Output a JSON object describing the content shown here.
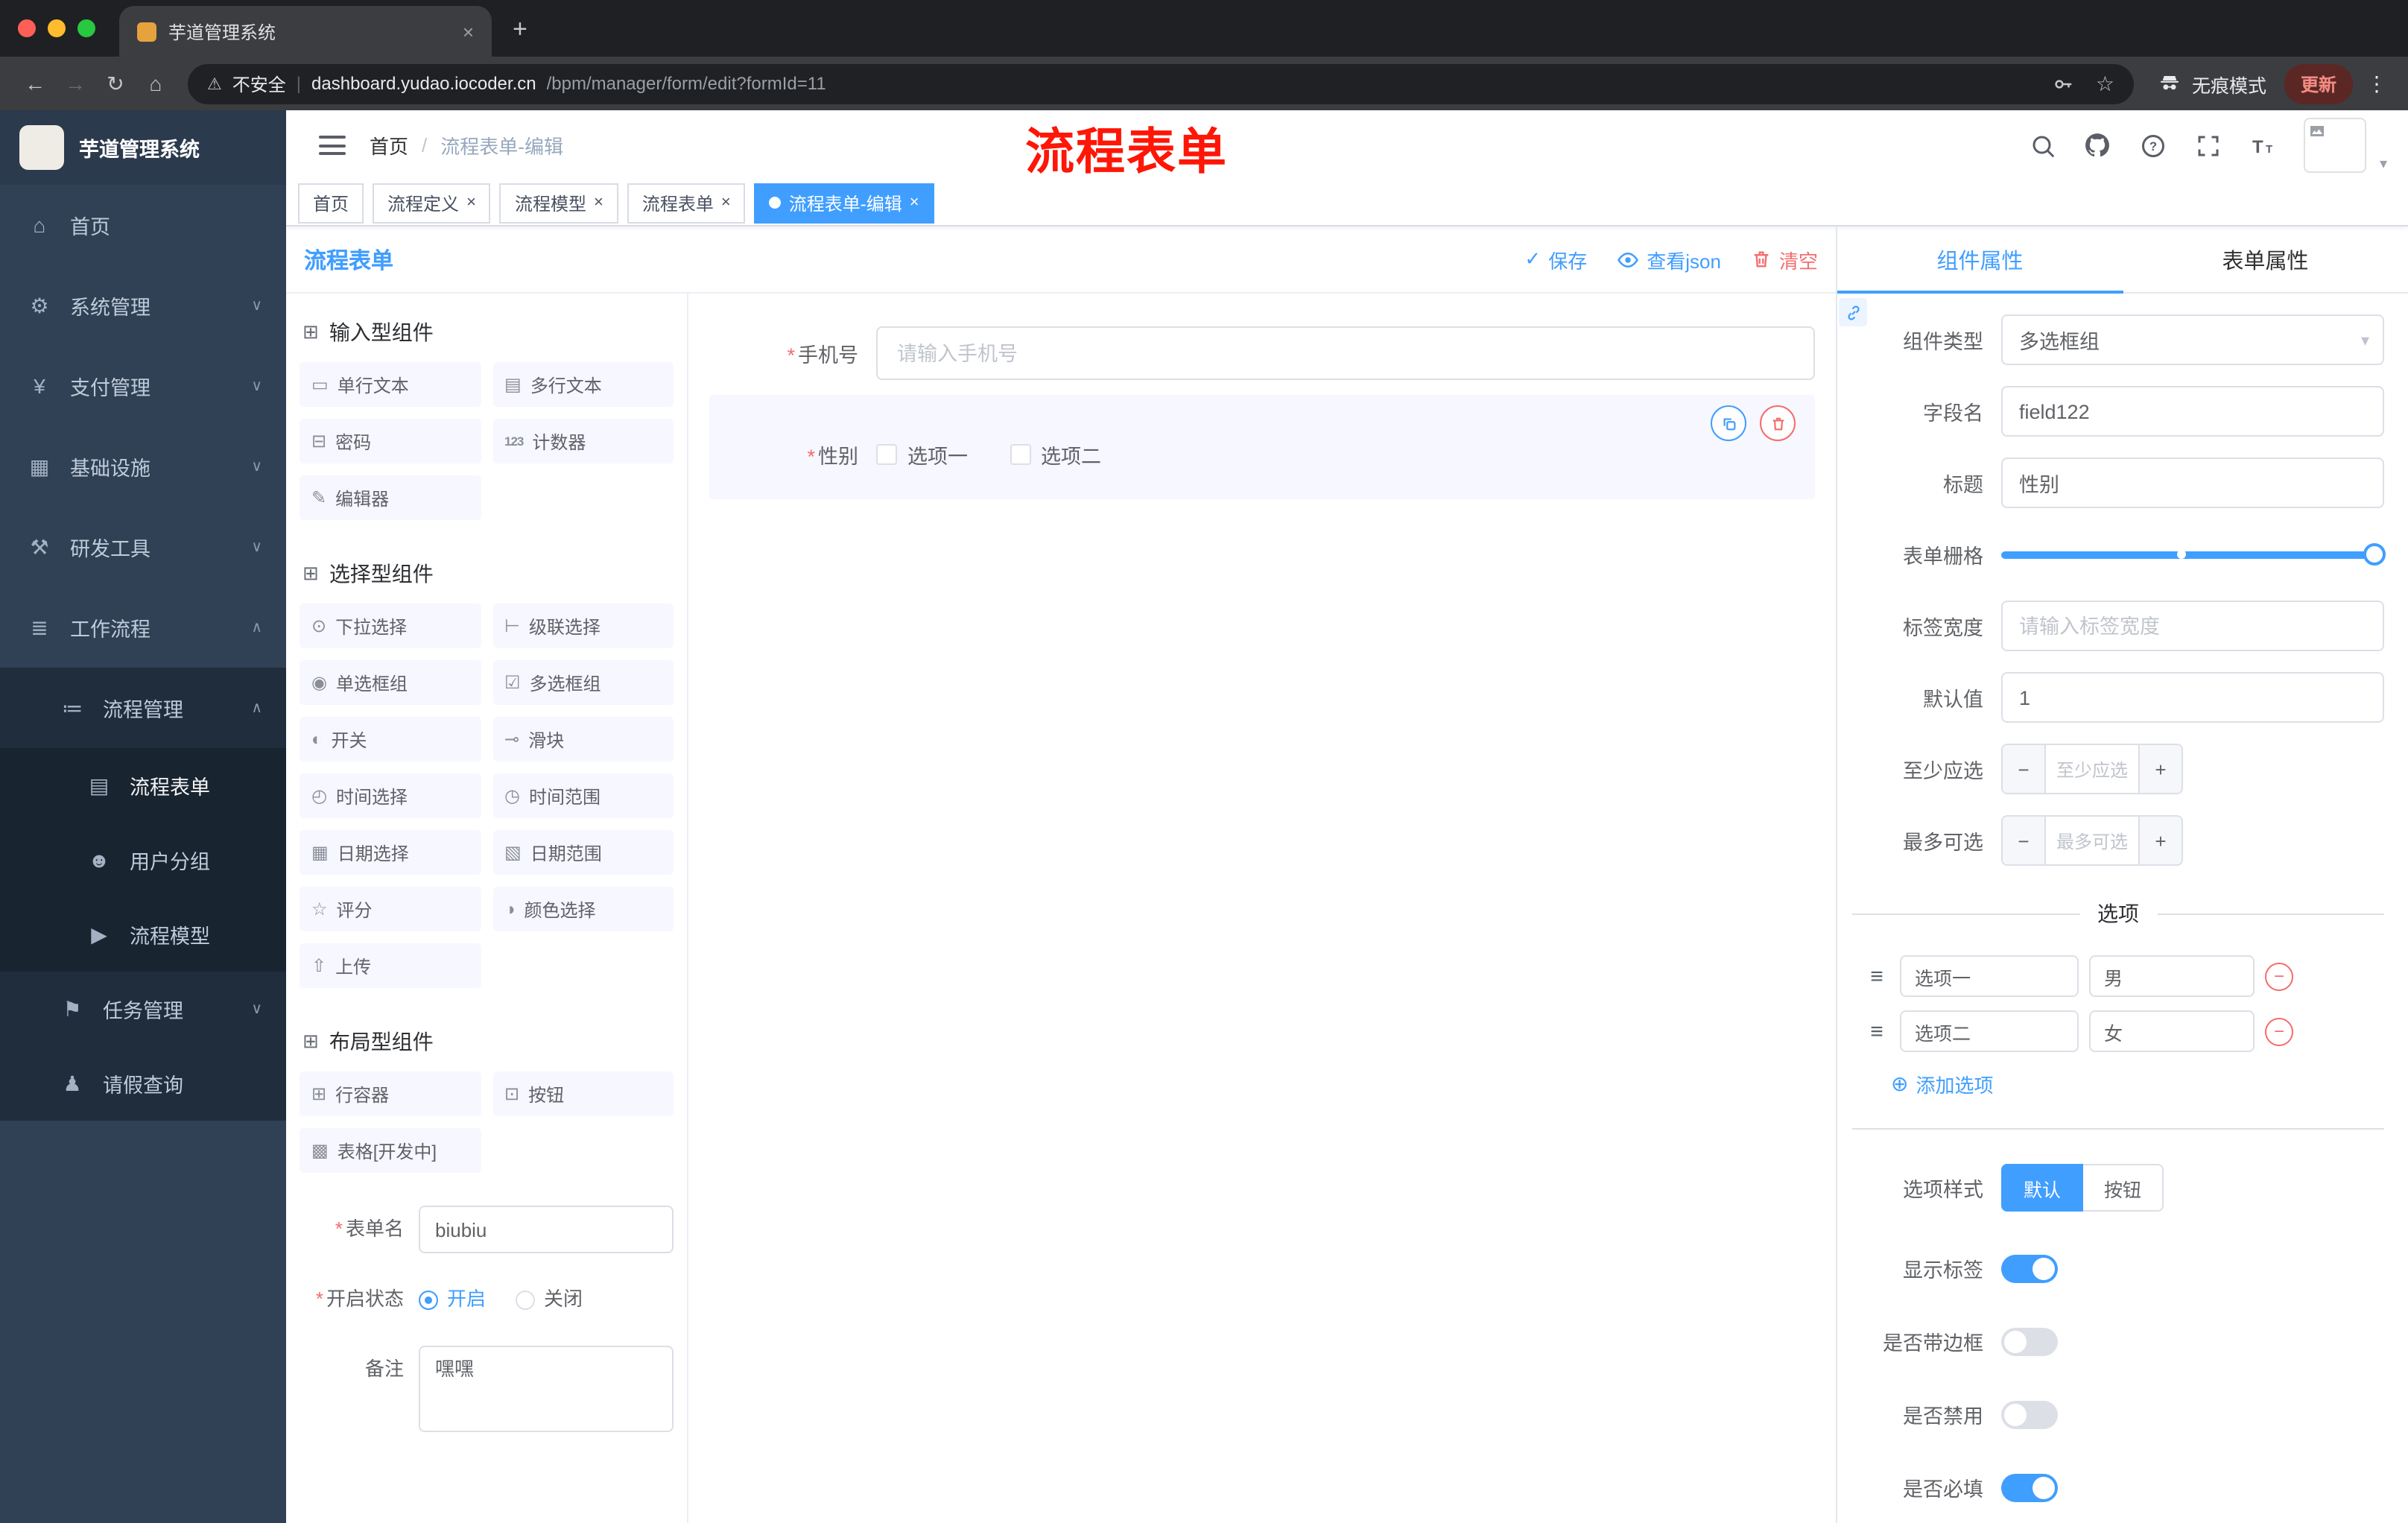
{
  "annotation": "流程表单",
  "glyphs": {
    "close": "×",
    "plus": "+",
    "minus": "−",
    "back": "←",
    "forward": "→",
    "reload": "↻",
    "home": "⌂",
    "warning": "⚠",
    "divider": "|",
    "star_outline": "☆",
    "dots": "⋮",
    "chevron_down": "∨",
    "chevron_up": "∧",
    "caret": "▾",
    "check": "✓",
    "slash": "/",
    "asterisk": "*",
    "add": "⊕",
    "drag": "≡",
    "dot": "●"
  },
  "browser": {
    "tab_title": "芋道管理系统",
    "security": "不安全",
    "url_domain": "dashboard.yudao.iocoder.cn",
    "url_path": "/bpm/manager/form/edit?formId=11",
    "incognito": "无痕模式",
    "update": "更新"
  },
  "sidebar": {
    "title": "芋道管理系统",
    "menu": [
      {
        "label": "首页",
        "icon": "⌂"
      },
      {
        "label": "系统管理",
        "icon": "⚙"
      },
      {
        "label": "支付管理",
        "icon": "¥"
      },
      {
        "label": "基础设施",
        "icon": "▦"
      },
      {
        "label": "研发工具",
        "icon": "⚒"
      },
      {
        "label": "工作流程",
        "icon": "≣"
      }
    ],
    "process_mgmt": {
      "label": "流程管理",
      "icon": "≔"
    },
    "process_children": [
      {
        "label": "流程表单",
        "icon": "▤"
      },
      {
        "label": "用户分组",
        "icon": "☻"
      },
      {
        "label": "流程模型",
        "icon": "▶"
      }
    ],
    "task_mgmt": {
      "label": "任务管理",
      "icon": "⚑"
    },
    "leave_query": {
      "label": "请假查询",
      "icon": "♟"
    }
  },
  "header": {
    "breadcrumb_home": "首页",
    "breadcrumb_current": "流程表单-编辑"
  },
  "tags": [
    {
      "label": "首页"
    },
    {
      "label": "流程定义"
    },
    {
      "label": "流程模型"
    },
    {
      "label": "流程表单"
    },
    {
      "label": "流程表单-编辑"
    }
  ],
  "designer": {
    "title": "流程表单",
    "save": "保存",
    "view_json": "查看json",
    "clear": "清空"
  },
  "palette": {
    "sections": [
      {
        "title": "输入型组件",
        "items": [
          {
            "label": "单行文本",
            "icon": "▭"
          },
          {
            "label": "多行文本",
            "icon": "▤"
          },
          {
            "label": "密码",
            "icon": "⊟"
          },
          {
            "label": "计数器",
            "icon": "123"
          },
          {
            "label": "编辑器",
            "icon": "✎"
          }
        ]
      },
      {
        "title": "选择型组件",
        "items": [
          {
            "label": "下拉选择",
            "icon": "⊙"
          },
          {
            "label": "级联选择",
            "icon": "⊢"
          },
          {
            "label": "单选框组",
            "icon": "◉"
          },
          {
            "label": "多选框组",
            "icon": "☑"
          },
          {
            "label": "开关",
            "icon": "◐"
          },
          {
            "label": "滑块",
            "icon": "⊸"
          },
          {
            "label": "时间选择",
            "icon": "◴"
          },
          {
            "label": "时间范围",
            "icon": "◷"
          },
          {
            "label": "日期选择",
            "icon": "▦"
          },
          {
            "label": "日期范围",
            "icon": "▧"
          },
          {
            "label": "评分",
            "icon": "☆"
          },
          {
            "label": "颜色选择",
            "icon": "◑"
          },
          {
            "label": "上传",
            "icon": "⇧"
          }
        ]
      },
      {
        "title": "布局型组件",
        "items": [
          {
            "label": "行容器",
            "icon": "⊞"
          },
          {
            "label": "按钮",
            "icon": "⊡"
          },
          {
            "label": "表格[开发中]",
            "icon": "▩"
          }
        ]
      }
    ]
  },
  "form_config": {
    "name_label": "表单名",
    "name_value": "biubiu",
    "status_label": "开启状态",
    "status_on": "开启",
    "status_off": "关闭",
    "remark_label": "备注",
    "remark_value": "嘿嘿"
  },
  "canvas": {
    "phone_label": "手机号",
    "phone_placeholder": "请输入手机号",
    "gender_label": "性别",
    "gender_opt1": "选项一",
    "gender_opt2": "选项二"
  },
  "panel": {
    "tab_component": "组件属性",
    "tab_form": "表单属性",
    "component_type_label": "组件类型",
    "component_type_value": "多选框组",
    "field_label": "字段名",
    "field_value": "field122",
    "title_label": "标题",
    "title_value": "性别",
    "grid_label": "表单栅格",
    "label_width_label": "标签宽度",
    "label_width_placeholder": "请输入标签宽度",
    "default_label": "默认值",
    "default_value": "1",
    "min_label": "至少应选",
    "min_placeholder": "至少应选",
    "max_label": "最多可选",
    "max_placeholder": "最多可选",
    "options_title": "选项",
    "options": [
      {
        "label": "选项一",
        "value": "男"
      },
      {
        "label": "选项二",
        "value": "女"
      }
    ],
    "add_option": "添加选项",
    "style_label": "选项样式",
    "style_default": "默认",
    "style_button": "按钮",
    "show_label": "显示标签",
    "with_border": "是否带边框",
    "is_disabled": "是否禁用",
    "is_required": "是否必填"
  }
}
